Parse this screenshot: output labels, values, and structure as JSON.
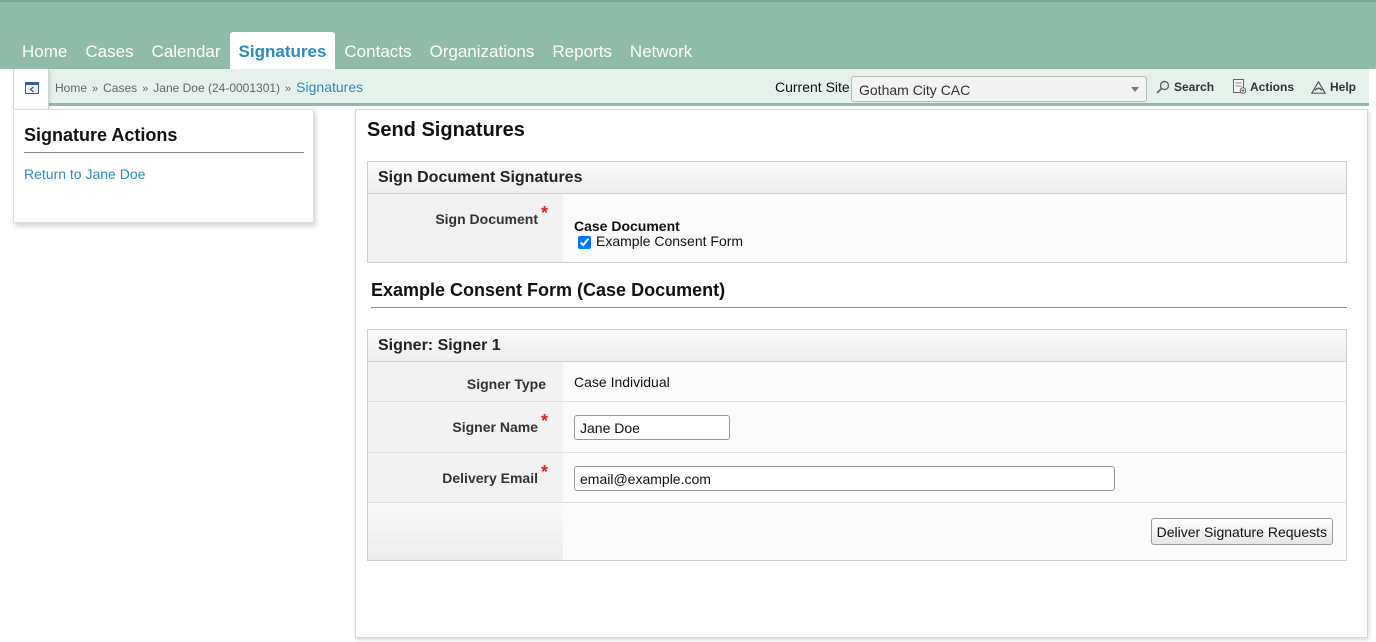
{
  "nav": {
    "tabs": [
      {
        "label": "Home"
      },
      {
        "label": "Cases"
      },
      {
        "label": "Calendar"
      },
      {
        "label": "Signatures",
        "active": true
      },
      {
        "label": "Contacts"
      },
      {
        "label": "Organizations"
      },
      {
        "label": "Reports"
      },
      {
        "label": "Network"
      }
    ]
  },
  "breadcrumb": {
    "items": [
      "Home",
      "Cases",
      "Jane Doe (24-0001301)"
    ],
    "separator": "»",
    "current": "Signatures"
  },
  "site": {
    "label": "Current Site",
    "selected": "Gotham City CAC"
  },
  "toolbar": {
    "search_label": "Search",
    "actions_label": "Actions",
    "help_label": "Help"
  },
  "sidebar": {
    "title": "Signature Actions",
    "link": "Return to Jane Doe"
  },
  "main": {
    "title": "Send Signatures",
    "sign_section": {
      "heading": "Sign Document Signatures",
      "label": "Sign Document",
      "doc_heading": "Case Document",
      "doc_option": "Example Consent Form",
      "doc_checked": true
    },
    "doc_title": "Example Consent Form (Case Document)",
    "signer_section": {
      "heading": "Signer: Signer 1",
      "type_label": "Signer Type",
      "type_value": "Case Individual",
      "name_label": "Signer Name",
      "name_value": "Jane Doe",
      "email_label": "Delivery Email",
      "email_value": "email@example.com",
      "submit_label": "Deliver Signature Requests"
    },
    "required_marker": "*"
  },
  "colors": {
    "header_green": "#8fbca8",
    "link_blue": "#2a8bbd",
    "required_red": "#e02020"
  }
}
